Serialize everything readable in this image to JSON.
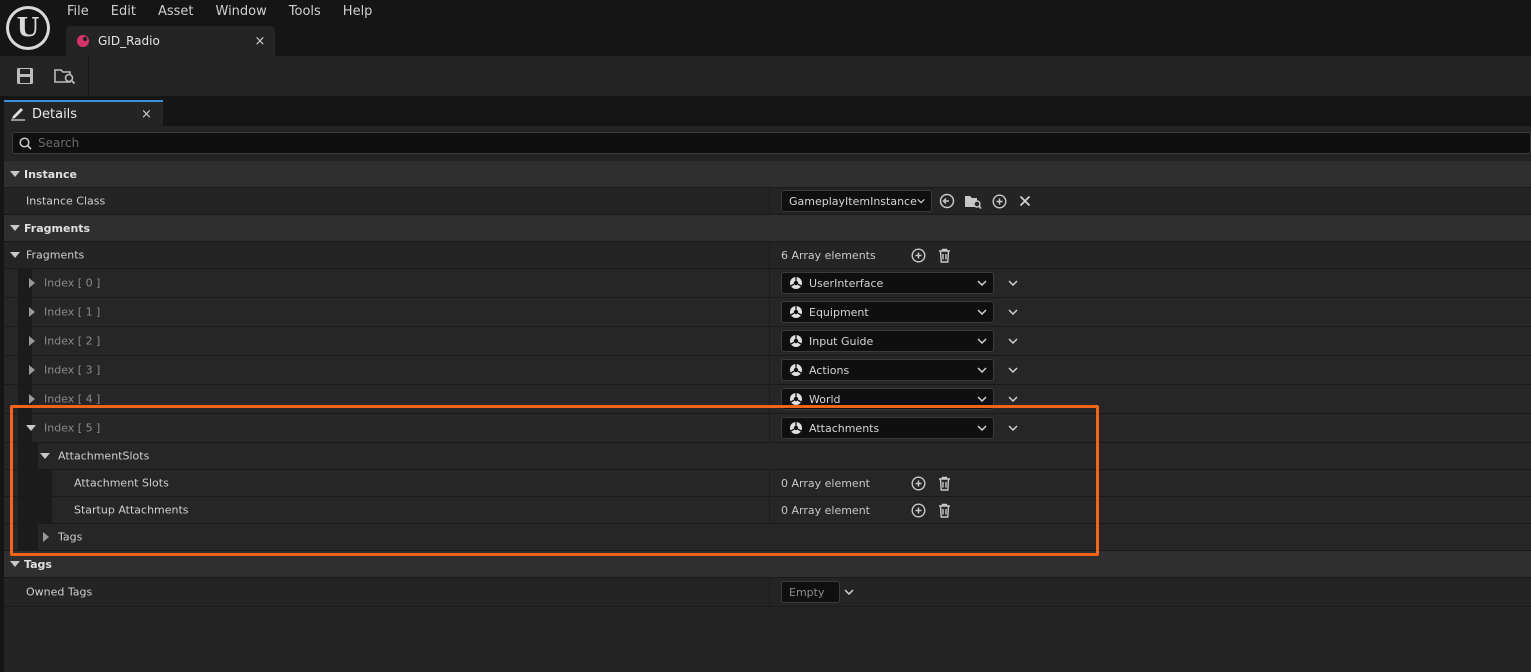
{
  "menu": {
    "items": [
      "File",
      "Edit",
      "Asset",
      "Window",
      "Tools",
      "Help"
    ]
  },
  "document_tab": {
    "label": "GID_Radio",
    "close": "×"
  },
  "details_tab": {
    "label": "Details",
    "close": "×"
  },
  "search": {
    "placeholder": "Search"
  },
  "categories": {
    "instance": "Instance",
    "fragments": "Fragments",
    "tags": "Tags"
  },
  "instance": {
    "instance_class_label": "Instance Class",
    "instance_class_value": "GameplayItemInstance"
  },
  "fragments": {
    "label": "Fragments",
    "count": "6 Array elements",
    "items": [
      {
        "index": "Index [ 0 ]",
        "value": "UserInterface"
      },
      {
        "index": "Index [ 1 ]",
        "value": "Equipment"
      },
      {
        "index": "Index [ 2 ]",
        "value": "Input Guide"
      },
      {
        "index": "Index [ 3 ]",
        "value": "Actions"
      },
      {
        "index": "Index [ 4 ]",
        "value": "World"
      },
      {
        "index": "Index [ 5 ]",
        "value": "Attachments"
      }
    ],
    "attachment_slots_group": "AttachmentSlots",
    "attachment_slots_label": "Attachment Slots",
    "attachment_slots_count": "0 Array element",
    "startup_attachments_label": "Startup Attachments",
    "startup_attachments_count": "0 Array element",
    "tags_group": "Tags"
  },
  "tags": {
    "owned_tags_label": "Owned Tags",
    "owned_tags_value": "Empty"
  },
  "colors": {
    "highlight": "#f26419",
    "tab_accent": "#3a8fd8",
    "asset_icon": "#d6336c"
  }
}
